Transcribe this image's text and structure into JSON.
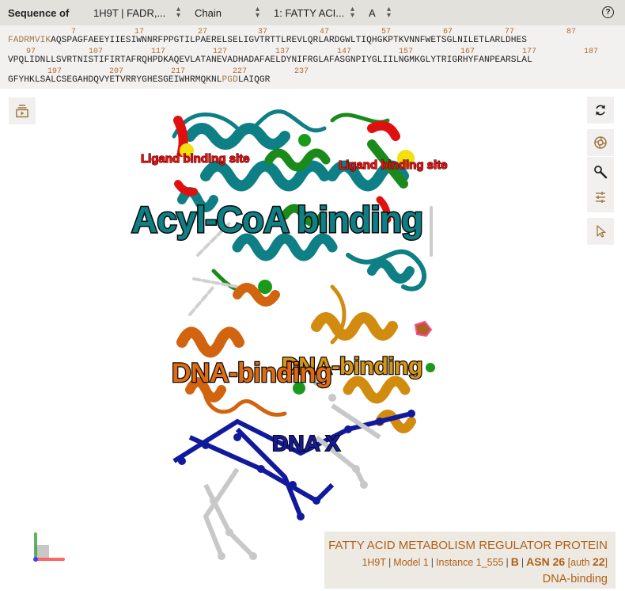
{
  "header": {
    "title": "Sequence of",
    "entry_select": "1H9T | FADR,...",
    "mode_select": "Chain",
    "entity_select": "1: FATTY ACI...",
    "chain_select": "A",
    "help_icon": "?"
  },
  "sequence": {
    "rows": [
      {
        "unmodeled_prefix": "FADRMVIK",
        "residues": "AQSPAGFAEEYIIESIWNNRFPPGTILPAERELSELIGVTRTTLREVLQRLARDGWLTIQHGKPTKVNNFWETSGLNILETLARLDHES",
        "unmodeled_suffix": "",
        "numbers": [
          "7",
          "17",
          "27",
          "37",
          "47",
          "57",
          "67",
          "77",
          "87"
        ]
      },
      {
        "unmodeled_prefix": "",
        "residues": "VPQLIDNLLSVRTNISTIFIRTAFRQHPDKAQEVLATANEVADHADAFAELDYNIFRGLAFASGNPIYGLIILNGMKGLYTRIGRHYFANPEARSLAL",
        "unmodeled_suffix": "",
        "numbers": [
          "97",
          "107",
          "117",
          "127",
          "137",
          "147",
          "157",
          "167",
          "177",
          "187"
        ]
      },
      {
        "unmodeled_prefix": "",
        "residues": "GFYHKLSALCSEGAHDQVYETVRRYGHESGEIWHRMQKNL",
        "unmodeled_middle": "PGD",
        "residues_after": "LAIQGR",
        "numbers": [
          "197",
          "207",
          "217",
          "227",
          "237"
        ]
      }
    ]
  },
  "viewer": {
    "left_toolbar": [
      {
        "icon": "animation-icon",
        "label": "Animation"
      }
    ],
    "right_toolbar": [
      {
        "icon": "reset-camera-icon",
        "label": "Reset Camera"
      },
      {
        "icon": "screenshot-icon",
        "label": "Screenshot"
      },
      {
        "icon": "wrench-icon",
        "label": "Settings"
      },
      {
        "icon": "sliders-icon",
        "label": "Controls"
      },
      {
        "icon": "pointer-icon",
        "label": "Selection Mode"
      }
    ],
    "labels": {
      "acyl": "Acyl-CoA binding",
      "dna_a": "DNA-binding",
      "dna_b": "DNA-binding",
      "dna_x": "DNA X",
      "ligand_1": "Ligand binding site",
      "ligand_2": "Ligand binding site"
    },
    "colors": {
      "teal": "#0f7f86",
      "green": "#1a8a1a",
      "orange": "#d2640f",
      "gold": "#d18c10",
      "dna_blue": "#111a9c",
      "dna_grey": "#c8c8c8",
      "ligand_red": "#e01010",
      "ligand_yellow": "#f2e010"
    }
  },
  "info_panel": {
    "title": "FATTY ACID METABOLISM REGULATOR PROTEIN",
    "entry": "1H9T",
    "model": "Model 1",
    "instance": "Instance 1_555",
    "chain": "B",
    "residue": "ASN 26",
    "auth_prefix": "[auth ",
    "auth_num": "22",
    "auth_suffix": "]",
    "domain": "DNA-binding"
  }
}
